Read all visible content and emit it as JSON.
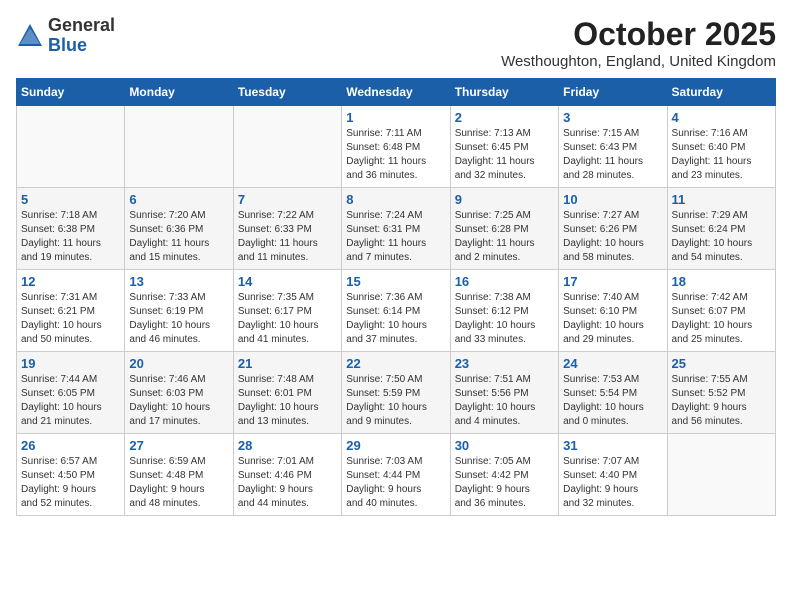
{
  "header": {
    "logo_general": "General",
    "logo_blue": "Blue",
    "title": "October 2025",
    "subtitle": "Westhoughton, England, United Kingdom"
  },
  "days_of_week": [
    "Sunday",
    "Monday",
    "Tuesday",
    "Wednesday",
    "Thursday",
    "Friday",
    "Saturday"
  ],
  "weeks": [
    [
      {
        "day": "",
        "info": ""
      },
      {
        "day": "",
        "info": ""
      },
      {
        "day": "",
        "info": ""
      },
      {
        "day": "1",
        "info": "Sunrise: 7:11 AM\nSunset: 6:48 PM\nDaylight: 11 hours\nand 36 minutes."
      },
      {
        "day": "2",
        "info": "Sunrise: 7:13 AM\nSunset: 6:45 PM\nDaylight: 11 hours\nand 32 minutes."
      },
      {
        "day": "3",
        "info": "Sunrise: 7:15 AM\nSunset: 6:43 PM\nDaylight: 11 hours\nand 28 minutes."
      },
      {
        "day": "4",
        "info": "Sunrise: 7:16 AM\nSunset: 6:40 PM\nDaylight: 11 hours\nand 23 minutes."
      }
    ],
    [
      {
        "day": "5",
        "info": "Sunrise: 7:18 AM\nSunset: 6:38 PM\nDaylight: 11 hours\nand 19 minutes."
      },
      {
        "day": "6",
        "info": "Sunrise: 7:20 AM\nSunset: 6:36 PM\nDaylight: 11 hours\nand 15 minutes."
      },
      {
        "day": "7",
        "info": "Sunrise: 7:22 AM\nSunset: 6:33 PM\nDaylight: 11 hours\nand 11 minutes."
      },
      {
        "day": "8",
        "info": "Sunrise: 7:24 AM\nSunset: 6:31 PM\nDaylight: 11 hours\nand 7 minutes."
      },
      {
        "day": "9",
        "info": "Sunrise: 7:25 AM\nSunset: 6:28 PM\nDaylight: 11 hours\nand 2 minutes."
      },
      {
        "day": "10",
        "info": "Sunrise: 7:27 AM\nSunset: 6:26 PM\nDaylight: 10 hours\nand 58 minutes."
      },
      {
        "day": "11",
        "info": "Sunrise: 7:29 AM\nSunset: 6:24 PM\nDaylight: 10 hours\nand 54 minutes."
      }
    ],
    [
      {
        "day": "12",
        "info": "Sunrise: 7:31 AM\nSunset: 6:21 PM\nDaylight: 10 hours\nand 50 minutes."
      },
      {
        "day": "13",
        "info": "Sunrise: 7:33 AM\nSunset: 6:19 PM\nDaylight: 10 hours\nand 46 minutes."
      },
      {
        "day": "14",
        "info": "Sunrise: 7:35 AM\nSunset: 6:17 PM\nDaylight: 10 hours\nand 41 minutes."
      },
      {
        "day": "15",
        "info": "Sunrise: 7:36 AM\nSunset: 6:14 PM\nDaylight: 10 hours\nand 37 minutes."
      },
      {
        "day": "16",
        "info": "Sunrise: 7:38 AM\nSunset: 6:12 PM\nDaylight: 10 hours\nand 33 minutes."
      },
      {
        "day": "17",
        "info": "Sunrise: 7:40 AM\nSunset: 6:10 PM\nDaylight: 10 hours\nand 29 minutes."
      },
      {
        "day": "18",
        "info": "Sunrise: 7:42 AM\nSunset: 6:07 PM\nDaylight: 10 hours\nand 25 minutes."
      }
    ],
    [
      {
        "day": "19",
        "info": "Sunrise: 7:44 AM\nSunset: 6:05 PM\nDaylight: 10 hours\nand 21 minutes."
      },
      {
        "day": "20",
        "info": "Sunrise: 7:46 AM\nSunset: 6:03 PM\nDaylight: 10 hours\nand 17 minutes."
      },
      {
        "day": "21",
        "info": "Sunrise: 7:48 AM\nSunset: 6:01 PM\nDaylight: 10 hours\nand 13 minutes."
      },
      {
        "day": "22",
        "info": "Sunrise: 7:50 AM\nSunset: 5:59 PM\nDaylight: 10 hours\nand 9 minutes."
      },
      {
        "day": "23",
        "info": "Sunrise: 7:51 AM\nSunset: 5:56 PM\nDaylight: 10 hours\nand 4 minutes."
      },
      {
        "day": "24",
        "info": "Sunrise: 7:53 AM\nSunset: 5:54 PM\nDaylight: 10 hours\nand 0 minutes."
      },
      {
        "day": "25",
        "info": "Sunrise: 7:55 AM\nSunset: 5:52 PM\nDaylight: 9 hours\nand 56 minutes."
      }
    ],
    [
      {
        "day": "26",
        "info": "Sunrise: 6:57 AM\nSunset: 4:50 PM\nDaylight: 9 hours\nand 52 minutes."
      },
      {
        "day": "27",
        "info": "Sunrise: 6:59 AM\nSunset: 4:48 PM\nDaylight: 9 hours\nand 48 minutes."
      },
      {
        "day": "28",
        "info": "Sunrise: 7:01 AM\nSunset: 4:46 PM\nDaylight: 9 hours\nand 44 minutes."
      },
      {
        "day": "29",
        "info": "Sunrise: 7:03 AM\nSunset: 4:44 PM\nDaylight: 9 hours\nand 40 minutes."
      },
      {
        "day": "30",
        "info": "Sunrise: 7:05 AM\nSunset: 4:42 PM\nDaylight: 9 hours\nand 36 minutes."
      },
      {
        "day": "31",
        "info": "Sunrise: 7:07 AM\nSunset: 4:40 PM\nDaylight: 9 hours\nand 32 minutes."
      },
      {
        "day": "",
        "info": ""
      }
    ]
  ]
}
